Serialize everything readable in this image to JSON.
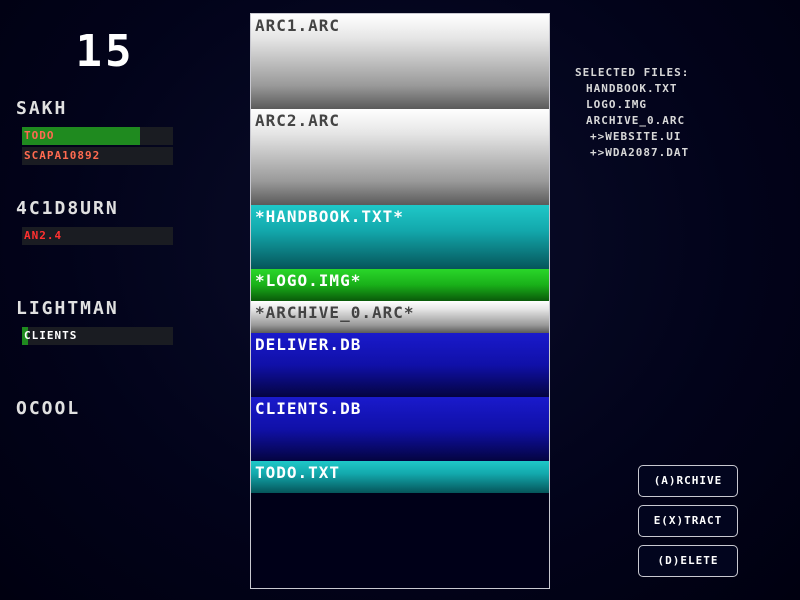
{
  "timer": "15",
  "players": [
    {
      "name": "SAKH",
      "tasks": [
        {
          "label": "TODO",
          "progress": 0.78,
          "label_color": "#ff6a50"
        },
        {
          "label": "SCAPA10892",
          "progress": 0.0,
          "label_color": "#ff6a50"
        }
      ]
    },
    {
      "name": "4C1D8URN",
      "tasks": [
        {
          "label": "AN2.4",
          "progress": 0.0,
          "label_color": "#ff3030"
        }
      ]
    },
    {
      "name": "LIGHTMAN",
      "tasks": [
        {
          "label": "CLIENTS",
          "progress": 0.04,
          "label_color": "#ffffff"
        }
      ]
    },
    {
      "name": "OCOOL",
      "tasks": []
    }
  ],
  "files": [
    {
      "name": "ARC1.ARC",
      "type": "archive"
    },
    {
      "name": "ARC2.ARC",
      "type": "archive"
    },
    {
      "name": "*HANDBOOK.TXT*",
      "type": "text"
    },
    {
      "name": "*LOGO.IMG*",
      "type": "image"
    },
    {
      "name": "*ARCHIVE_0.ARC*",
      "type": "archive"
    },
    {
      "name": "DELIVER.DB",
      "type": "db"
    },
    {
      "name": "CLIENTS.DB",
      "type": "db"
    },
    {
      "name": "TODO.TXT",
      "type": "text"
    }
  ],
  "selected": {
    "title": "SELECTED FILES:",
    "items": [
      "HANDBOOK.TXT",
      "LOGO.IMG",
      "ARCHIVE_0.ARC",
      "+>WEBSITE.UI",
      "+>WDA2087.DAT"
    ]
  },
  "actions": {
    "archive": "(A)RCHIVE",
    "extract": "E(X)TRACT",
    "delete": "(D)ELETE"
  }
}
